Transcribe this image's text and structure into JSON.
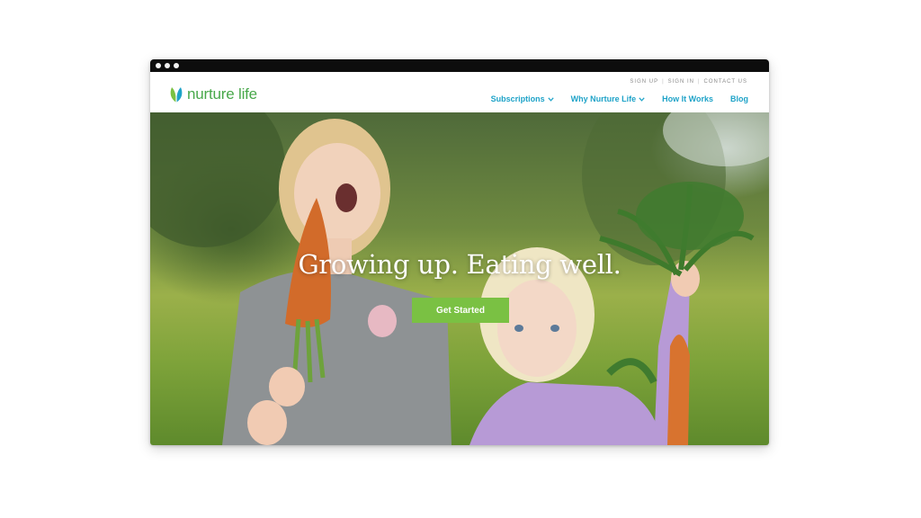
{
  "site": {
    "logo_text": "nurture life"
  },
  "utility_nav": {
    "sign_up": "SIGN UP",
    "sign_in": "SIGN IN",
    "contact_us": "CONTACT US",
    "separator": "|"
  },
  "main_nav": {
    "items": [
      {
        "label": "Subscriptions",
        "has_dropdown": true
      },
      {
        "label": "Why Nurture Life",
        "has_dropdown": true
      },
      {
        "label": "How It Works",
        "has_dropdown": false
      },
      {
        "label": "Blog",
        "has_dropdown": false
      }
    ]
  },
  "hero": {
    "headline": "Growing up. Eating well.",
    "cta_label": "Get Started"
  },
  "colors": {
    "brand_green": "#48a84a",
    "nav_blue": "#1fa3c8",
    "cta_green": "#7ac143"
  },
  "icons": [
    "leaf-logo-icon",
    "chevron-down-icon"
  ]
}
